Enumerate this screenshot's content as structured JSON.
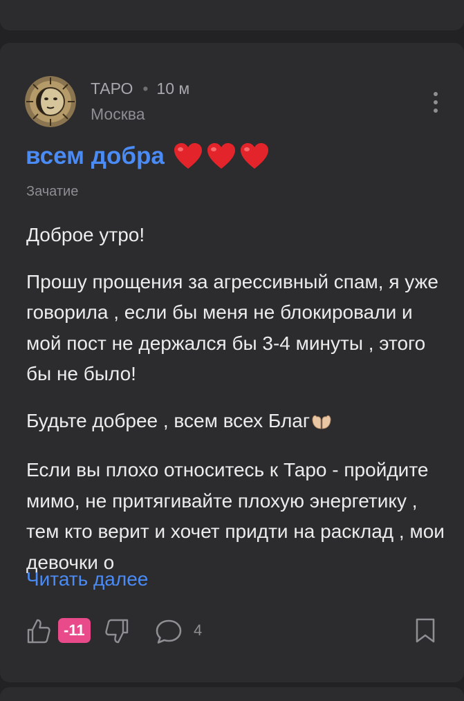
{
  "post": {
    "author": "ТАРО",
    "separator": "•",
    "time": "10 м",
    "city": "Москва",
    "title": "всем добра",
    "category": "Зачатие",
    "paragraphs": [
      "Доброе утро!",
      "Прошу прощения за агрессивный спам, я уже говорила , если бы меня не блокировали и мой пост не держался бы 3-4 минуты , этого бы не было!",
      "Будьте добрее , всем всех Благ",
      "Если вы плохо относитесь к Таро - пройдите мимо, не притягивайте плохую энергетику , тем кто верит и хочет придти на расклад , мои девочки о"
    ],
    "read_more": "Читать далее",
    "score": "-11",
    "comment_count": "4"
  },
  "colors": {
    "background": "#222224",
    "card": "#2c2c2e",
    "accent": "#4a8bf5",
    "score_badge": "#e84a8a",
    "text": "#ececec",
    "muted": "#8e8e93"
  },
  "icons": {
    "avatar": "tarot-sun-moon-avatar",
    "more": "more-vertical-icon",
    "title_emoji": "red-heart-emoji",
    "inline_emoji": "palms-up-together-emoji",
    "like": "thumbs-up-icon",
    "dislike": "thumbs-down-icon",
    "comment": "comment-bubble-icon",
    "bookmark": "bookmark-icon"
  }
}
